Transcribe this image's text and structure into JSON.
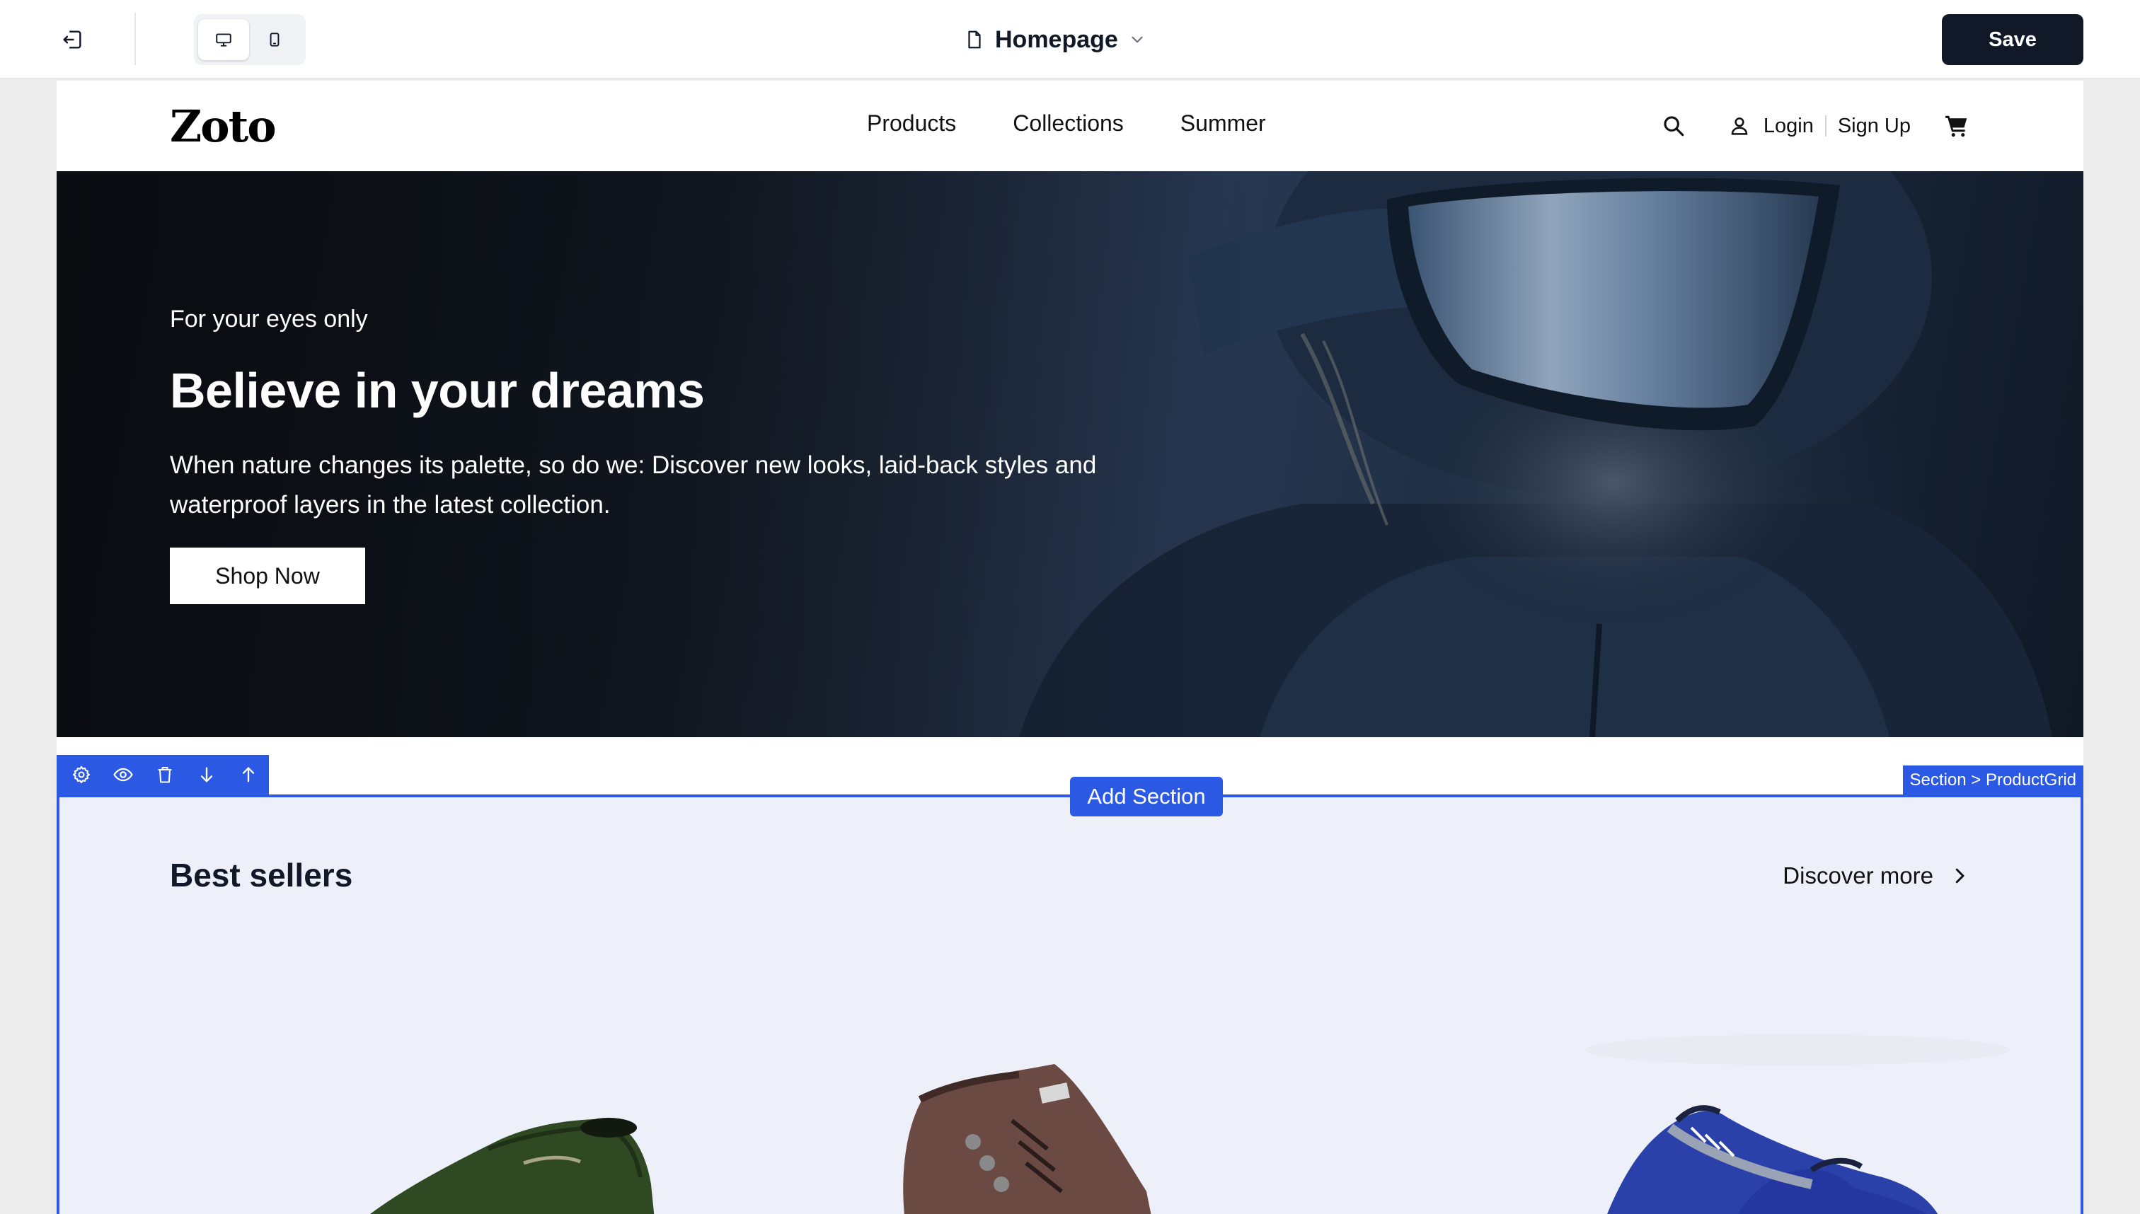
{
  "editor": {
    "page_name": "Homepage",
    "save_label": "Save",
    "icons": {
      "exit": "exit-icon",
      "desktop": "desktop-icon",
      "mobile": "mobile-icon",
      "page": "file-icon",
      "chevron": "chevron-down-icon"
    },
    "active_device": "desktop",
    "accent_color": "#2b59e3",
    "save_color": "#111827"
  },
  "site": {
    "logo": "Zoto",
    "nav": [
      {
        "label": "Products"
      },
      {
        "label": "Collections"
      },
      {
        "label": "Summer"
      }
    ],
    "login_label": "Login",
    "signup_label": "Sign Up"
  },
  "hero": {
    "eyebrow": "For your eyes only",
    "title": "Believe in your dreams",
    "description": "When nature changes its palette, so do we: Discover new looks, laid-back styles and waterproof layers in the latest collection.",
    "cta_label": "Shop Now"
  },
  "section": {
    "add_section_label": "Add Section",
    "breadcrumb_label": "Section > ProductGrid",
    "toolbar_icons": [
      "settings-icon",
      "eye-icon",
      "trash-icon",
      "arrow-down-icon",
      "arrow-up-icon"
    ],
    "title": "Best sellers",
    "discover_label": "Discover more"
  },
  "products": [
    {
      "name": "green-leather-shoe",
      "color": "#2f4a22"
    },
    {
      "name": "brown-suede-boot",
      "color": "#6b4a44"
    },
    {
      "name": "blue-running-shoe",
      "color": "#2941a8"
    }
  ]
}
